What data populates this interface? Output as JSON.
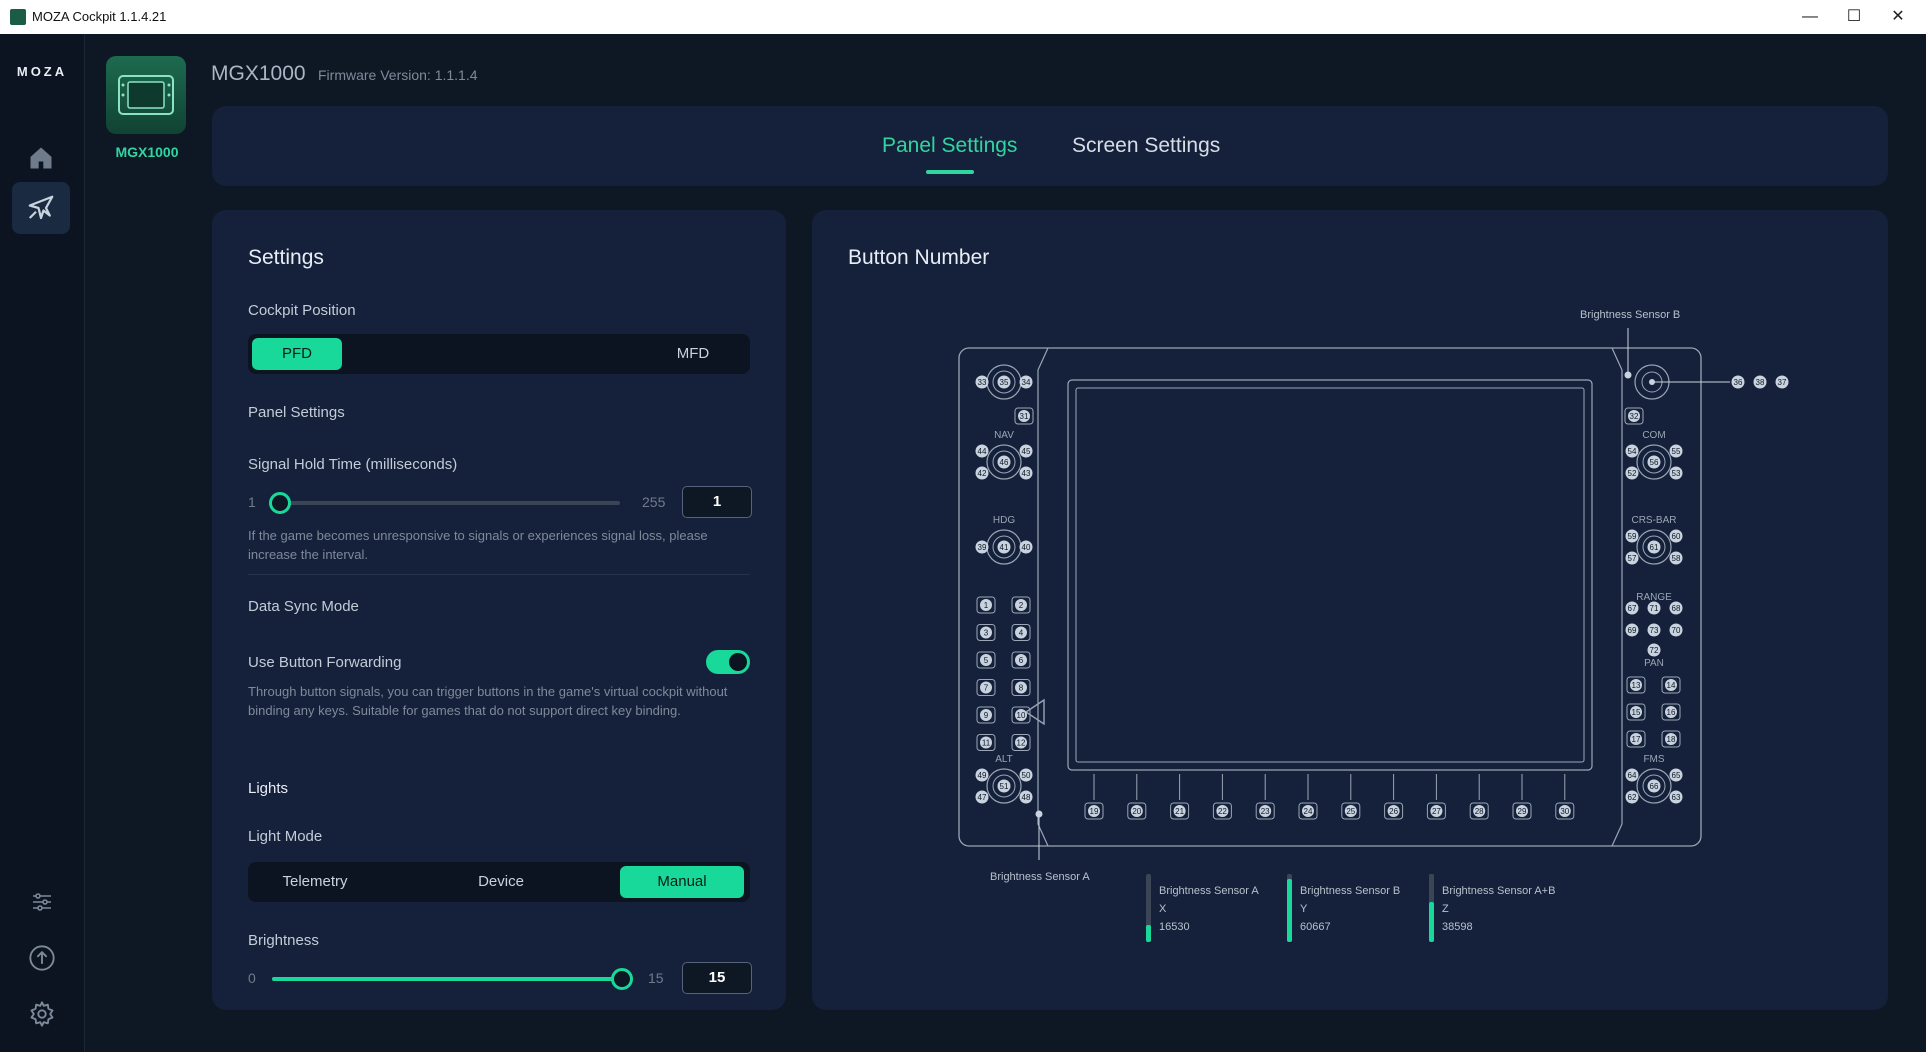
{
  "window": {
    "title": "MOZA Cockpit 1.1.4.21",
    "minimize": "—",
    "maximize": "☐",
    "close": "✕"
  },
  "sidebar": {
    "logo": "MOZA",
    "items": [
      {
        "icon": "home-icon"
      },
      {
        "icon": "airplane-icon"
      }
    ],
    "bottom": [
      {
        "icon": "sliders-icon"
      },
      {
        "icon": "upload-icon"
      },
      {
        "icon": "gear-icon"
      }
    ]
  },
  "device": {
    "label": "MGX1000",
    "name": "MGX1000",
    "firmware": "Firmware Version: 1.1.1.4"
  },
  "tabs": [
    {
      "label": "Panel Settings",
      "active": true
    },
    {
      "label": "Screen Settings",
      "active": false
    }
  ],
  "settings": {
    "title": "Settings",
    "cockpit_position": {
      "label": "Cockpit Position",
      "options": [
        "PFD",
        "MFD"
      ],
      "selected": "PFD"
    },
    "panel_settings_label": "Panel Settings",
    "signal_hold": {
      "label": "Signal Hold Time (milliseconds)",
      "min": "1",
      "max": "255",
      "value": "1",
      "level": 0.0,
      "help": "If the game becomes unresponsive to signals or experiences signal loss, please increase the interval."
    },
    "data_sync_label": "Data Sync Mode",
    "button_forwarding": {
      "label": "Use Button Forwarding",
      "on": true,
      "help": "Through button signals, you can trigger buttons in the game's virtual cockpit without binding any keys. Suitable for games that do not support direct key binding."
    },
    "lights_label": "Lights",
    "light_mode": {
      "label": "Light Mode",
      "options": [
        "Telemetry",
        "Device",
        "Manual"
      ],
      "selected": "Manual"
    },
    "brightness": {
      "label": "Brightness",
      "min": "0",
      "max": "15",
      "value": "15",
      "level": 1.0
    }
  },
  "button_panel": {
    "title": "Button Number",
    "sensor_b_label": "Brightness Sensor B",
    "sensor_a_label": "Brightness Sensor A",
    "left_knobs": [
      {
        "label": "",
        "l": "33",
        "c": "35",
        "r": "34"
      },
      {
        "label": "NAV",
        "tl": "44",
        "tr": "45",
        "c": "46",
        "bl": "42",
        "br": "43"
      },
      {
        "label": "HDG",
        "l": "39",
        "c": "41",
        "r": "40"
      },
      {
        "label": "ALT",
        "tl": "49",
        "tr": "50",
        "c": "51",
        "bl": "47",
        "br": "48"
      }
    ],
    "left_extra": "31",
    "left_grid": [
      "1",
      "2",
      "3",
      "4",
      "5",
      "6",
      "7",
      "8",
      "9",
      "10",
      "11",
      "12"
    ],
    "right_knobs": [
      {
        "label": "COM",
        "tl": "54",
        "tr": "55",
        "c": "56",
        "bl": "52",
        "br": "53"
      },
      {
        "label": "CRS-BAR",
        "tl": "59",
        "tr": "60",
        "c": "61",
        "bl": "57",
        "br": "58"
      },
      {
        "label": "FMS",
        "tl": "64",
        "tr": "65",
        "c": "66",
        "bl": "62",
        "br": "63"
      }
    ],
    "right_extra": "32",
    "top_right_buttons": [
      "36",
      "38",
      "37"
    ],
    "range": {
      "label": "RANGE",
      "buttons": [
        "67",
        "71",
        "68",
        "69",
        "73",
        "70",
        "72"
      ]
    },
    "pan": {
      "label": "PAN",
      "buttons": [
        "13",
        "14",
        "15",
        "16",
        "17",
        "18"
      ]
    },
    "bottom_buttons": [
      "19",
      "20",
      "21",
      "22",
      "23",
      "24",
      "25",
      "26",
      "27",
      "28",
      "29",
      "30"
    ],
    "sensors": [
      {
        "name": "Brightness Sensor A",
        "axis": "X",
        "value": "16530",
        "level": 0.25
      },
      {
        "name": "Brightness Sensor B",
        "axis": "Y",
        "value": "60667",
        "level": 0.93
      },
      {
        "name": "Brightness Sensor A+B",
        "axis": "Z",
        "value": "38598",
        "level": 0.59
      }
    ]
  },
  "colors": {
    "accent": "#18d99a",
    "accent_text": "#2fd6a0",
    "bg": "#0e1724",
    "panel": "#15213a"
  }
}
